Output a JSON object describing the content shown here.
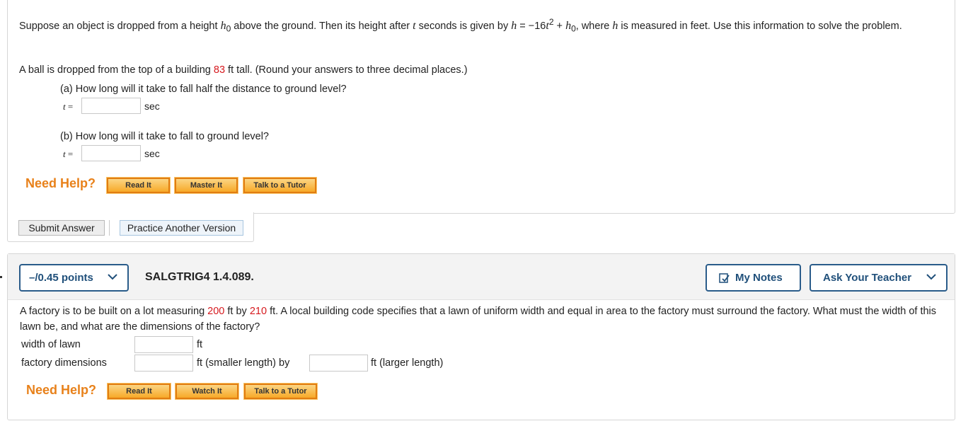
{
  "q1": {
    "intro_1": "Suppose an object is dropped from a height ",
    "h0_var": "h",
    "h0_sub": "0",
    "intro_2": " above the ground. Then its height after ",
    "t_var": "t",
    "intro_3": " seconds is given by  ",
    "formula_h": "h",
    "formula_mid": " = −16",
    "formula_t": "t",
    "formula_exp": "2",
    "formula_plus": " + ",
    "formula_h0": "h",
    "formula_h0_sub": "0",
    "intro_4": ",  where ",
    "h_var": "h",
    "intro_5": " is measured in feet. Use this information to solve the problem.",
    "given_1": "A ball is dropped from the top of a building ",
    "height_value": "83",
    "given_2": " ft tall. (Round your answers to three decimal places.)",
    "part_a": "(a) How long will it take to fall half the distance to ground level?",
    "part_b": "(b) How long will it take to fall to ground level?",
    "t_label_var": "t",
    "t_label_eq": " =",
    "unit_sec": "sec",
    "need_help": "Need Help?",
    "btn_read": "Read It",
    "btn_master": "Master It",
    "btn_tutor": "Talk to a Tutor",
    "submit": "Submit Answer",
    "practice": "Practice Another Version"
  },
  "q2": {
    "points": "–/0.45 points",
    "id": "SALGTRIG4 1.4.089.",
    "my_notes": "My Notes",
    "ask_teacher": "Ask Your Teacher",
    "text_1": "A factory is to be built on a lot measuring ",
    "lot_w": "200",
    "text_2": " ft by ",
    "lot_l": "210",
    "text_3": " ft. A local building code specifies that a lawn of uniform width and equal in area to the factory must surround the factory. What must the width of this lawn be, and what are the dimensions of the factory?",
    "label_width": "width of lawn",
    "unit_ft": "ft",
    "label_dims": "factory dimensions",
    "unit_smaller": "ft (smaller length) by",
    "unit_larger": "ft (larger length)",
    "need_help": "Need Help?",
    "btn_read": "Read It",
    "btn_watch": "Watch It",
    "btn_tutor": "Talk to a Tutor"
  },
  "colors": {
    "accent_red": "#d6191e",
    "help_orange": "#e8811a",
    "btn_blue": "#1f4f7a"
  }
}
